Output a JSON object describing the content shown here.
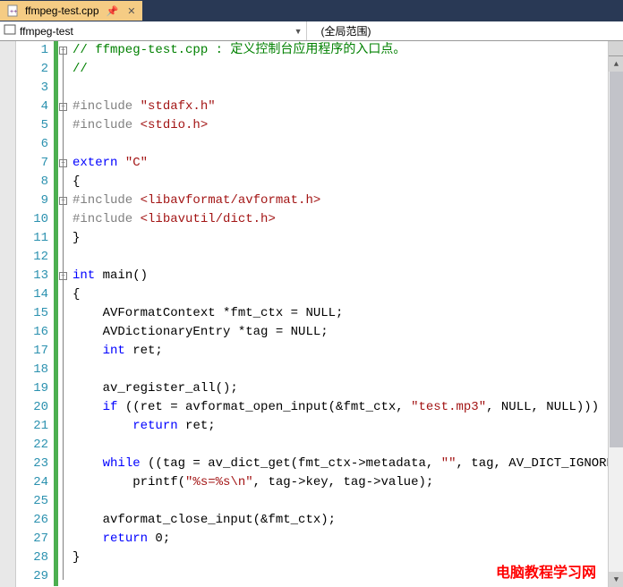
{
  "tab": {
    "filename": "ffmpeg-test.cpp"
  },
  "dropdowns": {
    "project": "ffmpeg-test",
    "scope": "(全局范围)"
  },
  "line_count": 29,
  "code_lines": [
    [
      [
        "c-comment",
        "// ffmpeg-test.cpp : 定义控制台应用程序的入口点。"
      ]
    ],
    [
      [
        "c-comment",
        "//"
      ]
    ],
    [],
    [
      [
        "c-ppkeyword",
        "#include "
      ],
      [
        "c-string",
        "\"stdafx.h\""
      ]
    ],
    [
      [
        "c-ppkeyword",
        "#include "
      ],
      [
        "c-string",
        "<stdio.h>"
      ]
    ],
    [],
    [
      [
        "c-keyword",
        "extern"
      ],
      [
        "c-default",
        " "
      ],
      [
        "c-string",
        "\"C\""
      ]
    ],
    [
      [
        "c-default",
        "{"
      ]
    ],
    [
      [
        "c-ppkeyword",
        "#include "
      ],
      [
        "c-string",
        "<libavformat/avformat.h>"
      ]
    ],
    [
      [
        "c-ppkeyword",
        "#include "
      ],
      [
        "c-string",
        "<libavutil/dict.h>"
      ]
    ],
    [
      [
        "c-default",
        "}"
      ]
    ],
    [],
    [
      [
        "c-keyword",
        "int"
      ],
      [
        "c-default",
        " main()"
      ]
    ],
    [
      [
        "c-default",
        "{"
      ]
    ],
    [
      [
        "c-default",
        "    AVFormatContext *fmt_ctx = NULL;"
      ]
    ],
    [
      [
        "c-default",
        "    AVDictionaryEntry *tag = NULL;"
      ]
    ],
    [
      [
        "c-default",
        "    "
      ],
      [
        "c-keyword",
        "int"
      ],
      [
        "c-default",
        " ret;"
      ]
    ],
    [],
    [
      [
        "c-default",
        "    av_register_all();"
      ]
    ],
    [
      [
        "c-default",
        "    "
      ],
      [
        "c-keyword",
        "if"
      ],
      [
        "c-default",
        " ((ret = avformat_open_input(&fmt_ctx, "
      ],
      [
        "c-string",
        "\"test.mp3\""
      ],
      [
        "c-default",
        ", NULL, NULL)))"
      ]
    ],
    [
      [
        "c-default",
        "        "
      ],
      [
        "c-keyword",
        "return"
      ],
      [
        "c-default",
        " ret;"
      ]
    ],
    [],
    [
      [
        "c-default",
        "    "
      ],
      [
        "c-keyword",
        "while"
      ],
      [
        "c-default",
        " ((tag = av_dict_get(fmt_ctx->metadata, "
      ],
      [
        "c-string",
        "\"\""
      ],
      [
        "c-default",
        ", tag, AV_DICT_IGNORE_SUFFIX)))"
      ]
    ],
    [
      [
        "c-default",
        "        printf("
      ],
      [
        "c-string",
        "\"%s=%s\\n\""
      ],
      [
        "c-default",
        ", tag->key, tag->value);"
      ]
    ],
    [],
    [
      [
        "c-default",
        "    avformat_close_input(&fmt_ctx);"
      ]
    ],
    [
      [
        "c-default",
        "    "
      ],
      [
        "c-keyword",
        "return"
      ],
      [
        "c-default",
        " 0;"
      ]
    ],
    [
      [
        "c-default",
        "}"
      ]
    ],
    []
  ],
  "change_marks": [
    1,
    2,
    3,
    4,
    5,
    6,
    7,
    8,
    9,
    10,
    11,
    12,
    13,
    14,
    15,
    16,
    17,
    18,
    19,
    20,
    21,
    22,
    23,
    24,
    25,
    26,
    27,
    28,
    29
  ],
  "fold_boxes": [
    1,
    4,
    7,
    9,
    13
  ],
  "watermark": "电脑教程学习网"
}
